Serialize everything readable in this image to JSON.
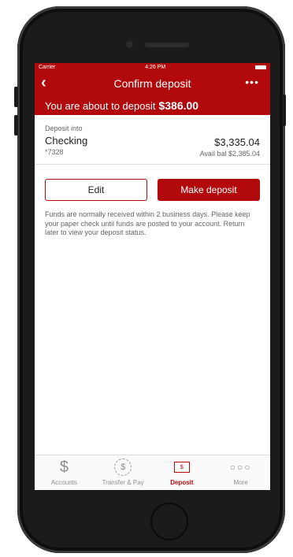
{
  "status_bar": {
    "carrier": "Carrier",
    "time": "4:26 PM"
  },
  "nav": {
    "title": "Confirm deposit",
    "back_icon": "chevron-left-icon",
    "more_label": "•••"
  },
  "banner": {
    "text": "You are about to deposit",
    "amount": "$386.00"
  },
  "account": {
    "deposit_into_label": "Deposit into",
    "name": "Checking",
    "number": "*7328",
    "balance": "$3,335.04",
    "available": "Avail bal $2,385.04"
  },
  "actions": {
    "edit_label": "Edit",
    "make_deposit_label": "Make deposit"
  },
  "notice": "Funds are normally received within 2 business days. Please keep your paper check until funds are posted to your account. Return later to view your deposit status.",
  "tabs": [
    {
      "label": "Accounts",
      "icon": "dollar-icon",
      "glyph": "$"
    },
    {
      "label": "Transfer & Pay",
      "icon": "transfer-icon",
      "glyph": "$"
    },
    {
      "label": "Deposit",
      "icon": "deposit-check-icon",
      "glyph": "$"
    },
    {
      "label": "More",
      "icon": "more-icon",
      "glyph": "○○○"
    }
  ],
  "colors": {
    "brand": "#b2090d"
  }
}
